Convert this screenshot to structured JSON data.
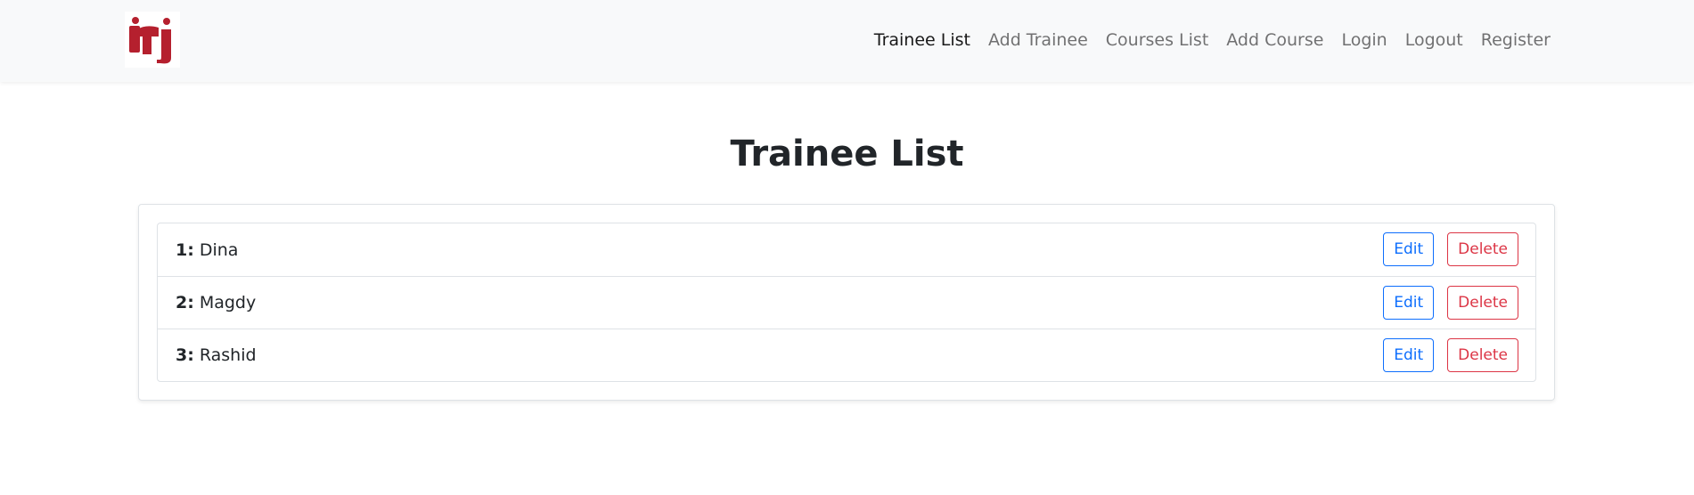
{
  "colors": {
    "brand_red": "#b5202e",
    "edit_blue": "#0d6efd",
    "delete_red": "#dc3545",
    "navbar_bg": "#f8f9fa"
  },
  "navbar": {
    "logo_icon": "iti-logo",
    "links": [
      {
        "label": "Trainee List",
        "active": true
      },
      {
        "label": "Add Trainee",
        "active": false
      },
      {
        "label": "Courses List",
        "active": false
      },
      {
        "label": "Add Course",
        "active": false
      },
      {
        "label": "Login",
        "active": false
      },
      {
        "label": "Logout",
        "active": false
      },
      {
        "label": "Register",
        "active": false
      }
    ]
  },
  "main": {
    "title": "Trainee List",
    "trainees": [
      {
        "number": "1:",
        "name": "Dina"
      },
      {
        "number": "2:",
        "name": "Magdy"
      },
      {
        "number": "3:",
        "name": "Rashid"
      }
    ],
    "edit_label": "Edit",
    "delete_label": "Delete"
  }
}
